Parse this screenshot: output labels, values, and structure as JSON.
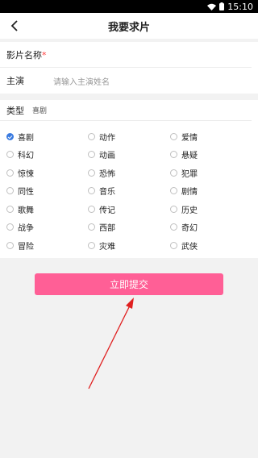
{
  "status_bar": {
    "time": "15:10"
  },
  "header": {
    "title": "我要求片"
  },
  "form": {
    "name_label": "影片名称",
    "required_mark": "*",
    "name_value": "",
    "actor_label": "主演",
    "actor_placeholder": "请输入主演姓名"
  },
  "types": {
    "label": "类型",
    "selected_value": "喜剧",
    "options": [
      {
        "label": "喜剧",
        "checked": true
      },
      {
        "label": "动作",
        "checked": false
      },
      {
        "label": "爱情",
        "checked": false
      },
      {
        "label": "科幻",
        "checked": false
      },
      {
        "label": "动画",
        "checked": false
      },
      {
        "label": "悬疑",
        "checked": false
      },
      {
        "label": "惊悚",
        "checked": false
      },
      {
        "label": "恐怖",
        "checked": false
      },
      {
        "label": "犯罪",
        "checked": false
      },
      {
        "label": "同性",
        "checked": false
      },
      {
        "label": "音乐",
        "checked": false
      },
      {
        "label": "剧情",
        "checked": false
      },
      {
        "label": "歌舞",
        "checked": false
      },
      {
        "label": "传记",
        "checked": false
      },
      {
        "label": "历史",
        "checked": false
      },
      {
        "label": "战争",
        "checked": false
      },
      {
        "label": "西部",
        "checked": false
      },
      {
        "label": "奇幻",
        "checked": false
      },
      {
        "label": "冒险",
        "checked": false
      },
      {
        "label": "灾难",
        "checked": false
      },
      {
        "label": "武侠",
        "checked": false
      }
    ]
  },
  "submit_label": "立即提交",
  "colors": {
    "accent": "#ff5f96",
    "radio_checked": "#3a7be0",
    "arrow": "#e02020"
  },
  "icons": {
    "back": "chevron-left-icon",
    "wifi": "wifi-icon",
    "battery": "battery-icon",
    "annotation": "red-arrow"
  }
}
